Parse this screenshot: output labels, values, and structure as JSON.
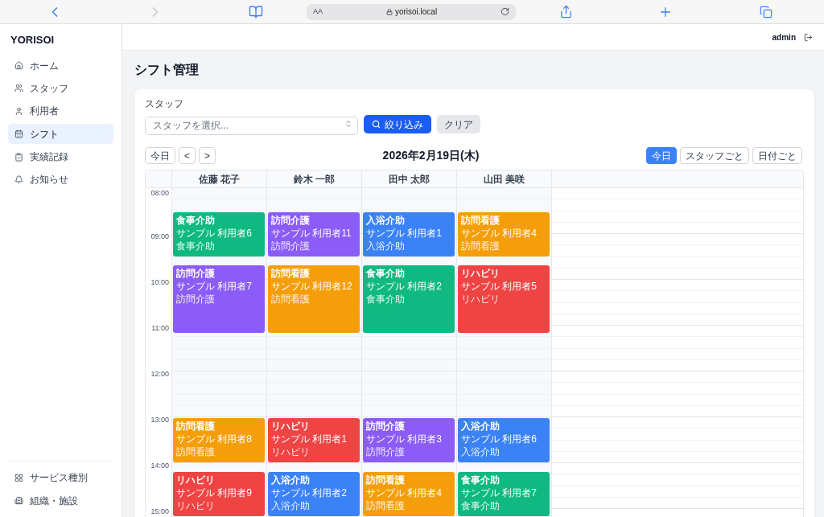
{
  "browser": {
    "reader_label": "AA",
    "url": "yorisoi.local"
  },
  "sidebar": {
    "logo": "YORISOI",
    "items": [
      {
        "label": "ホーム",
        "selected": false
      },
      {
        "label": "スタッフ",
        "selected": false
      },
      {
        "label": "利用者",
        "selected": false
      },
      {
        "label": "シフト",
        "selected": true
      },
      {
        "label": "実績記録",
        "selected": false
      },
      {
        "label": "お知らせ",
        "selected": false
      }
    ],
    "bottom_items": [
      {
        "label": "サービス種別",
        "selected": false
      },
      {
        "label": "組織・施設",
        "selected": false
      }
    ]
  },
  "header": {
    "user": "admin"
  },
  "page_title": "シフト管理",
  "filter": {
    "label": "スタッフ",
    "placeholder": "スタッフを選択...",
    "buttons": [
      {
        "label": "絞り込み",
        "kind": "primary"
      },
      {
        "label": "クリア",
        "kind": "secondary"
      }
    ]
  },
  "toolbar": {
    "nav_buttons": [
      "今日",
      "<",
      ">"
    ],
    "date": "2026年2月19日(木)",
    "views": [
      {
        "label": "今日",
        "selected": true
      },
      {
        "label": "スタッフごと",
        "selected": false
      },
      {
        "label": "日付ごと",
        "selected": false
      }
    ]
  },
  "calendar": {
    "times": [
      "08:00",
      "09:00",
      "10:00",
      "11:00",
      "12:00",
      "13:00",
      "14:00",
      "15:00"
    ],
    "columns": [
      {
        "name": "佐藤 花子",
        "events": [
          {
            "title": "食事介助",
            "client": "サンプル 利用者6",
            "service": "食事介助",
            "color": "#10b981"
          },
          {
            "title": "訪問介護",
            "client": "サンプル 利用者7",
            "service": "訪問介護",
            "color": "#8b5cf6"
          },
          {
            "title": "訪問看護",
            "client": "サンプル 利用者8",
            "service": "訪問看護",
            "color": "#f59e0b"
          },
          {
            "title": "リハビリ",
            "client": "サンプル 利用者9",
            "service": "リハビリ",
            "color": "#ef4444"
          }
        ]
      },
      {
        "name": "鈴木 一郎",
        "events": [
          {
            "title": "訪問介護",
            "client": "サンプル 利用者11",
            "service": "訪問介護",
            "color": "#8b5cf6"
          },
          {
            "title": "訪問看護",
            "client": "サンプル 利用者12",
            "service": "訪問看護",
            "color": "#f59e0b"
          },
          {
            "title": "リハビリ",
            "client": "サンプル 利用者1",
            "service": "リハビリ",
            "color": "#ef4444"
          },
          {
            "title": "入浴介助",
            "client": "サンプル 利用者2",
            "service": "入浴介助",
            "color": "#3b82f6"
          }
        ]
      },
      {
        "name": "田中 太郎",
        "events": [
          {
            "title": "入浴介助",
            "client": "サンプル 利用者1",
            "service": "入浴介助",
            "color": "#3b82f6"
          },
          {
            "title": "食事介助",
            "client": "サンプル 利用者2",
            "service": "食事介助",
            "color": "#10b981"
          },
          {
            "title": "訪問介護",
            "client": "サンプル 利用者3",
            "service": "訪問介護",
            "color": "#8b5cf6"
          },
          {
            "title": "訪問看護",
            "client": "サンプル 利用者4",
            "service": "訪問看護",
            "color": "#f59e0b"
          }
        ]
      },
      {
        "name": "山田 美咲",
        "events": [
          {
            "title": "訪問看護",
            "client": "サンプル 利用者4",
            "service": "訪問看護",
            "color": "#f59e0b"
          },
          {
            "title": "リハビリ",
            "client": "サンプル 利用者5",
            "service": "リハビリ",
            "color": "#ef4444"
          },
          {
            "title": "入浴介助",
            "client": "サンプル 利用者6",
            "service": "入浴介助",
            "color": "#3b82f6"
          },
          {
            "title": "食事介助",
            "client": "サンプル 利用者7",
            "service": "食事介助",
            "color": "#10b981"
          }
        ]
      }
    ]
  }
}
